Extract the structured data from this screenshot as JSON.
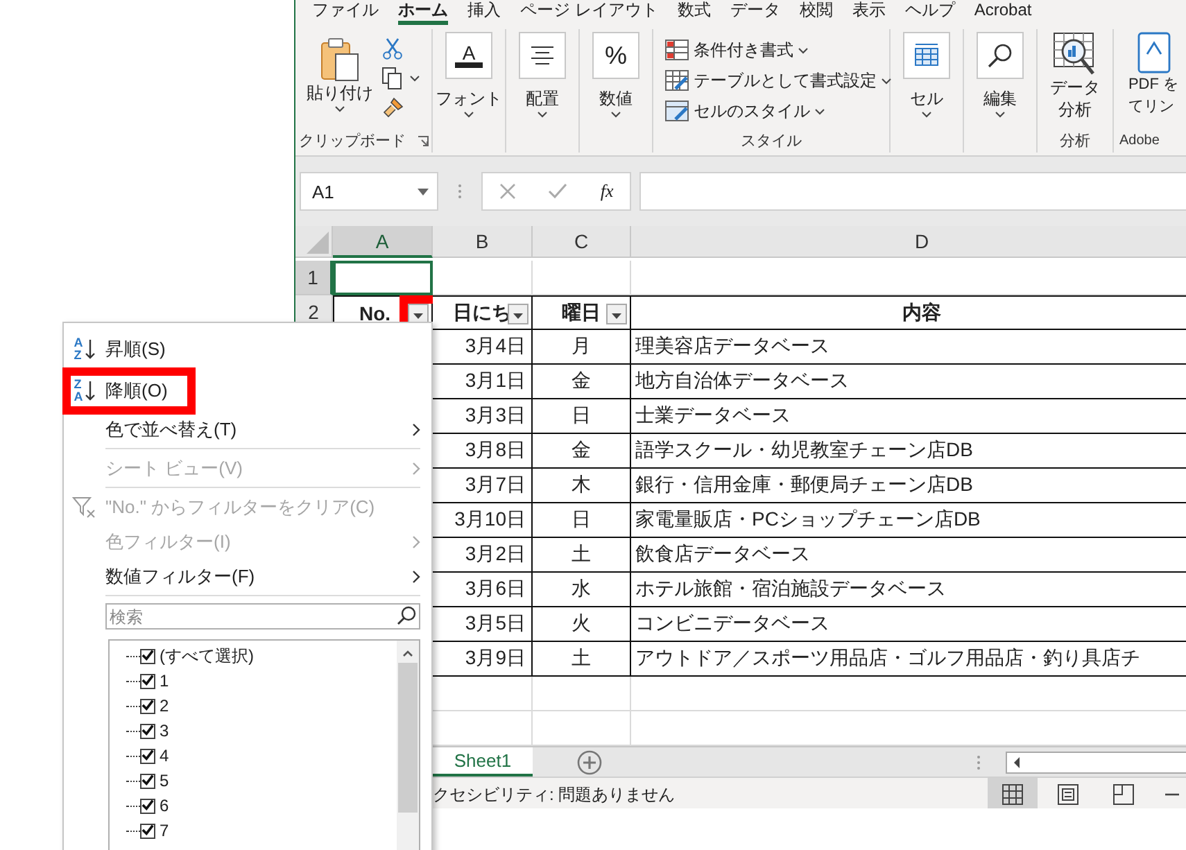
{
  "ribbon_tabs": [
    {
      "label": "ファイル",
      "selected": false
    },
    {
      "label": "ホーム",
      "selected": true
    },
    {
      "label": "挿入",
      "selected": false
    },
    {
      "label": "ページ レイアウト",
      "selected": false
    },
    {
      "label": "数式",
      "selected": false
    },
    {
      "label": "データ",
      "selected": false
    },
    {
      "label": "校閲",
      "selected": false
    },
    {
      "label": "表示",
      "selected": false
    },
    {
      "label": "ヘルプ",
      "selected": false
    },
    {
      "label": "Acrobat",
      "selected": false
    }
  ],
  "ribbon_groups": [
    {
      "kind": "clipboard",
      "paste": "貼り付け",
      "label": "クリップボード"
    },
    {
      "kind": "font",
      "glyph": "A",
      "title": "フォント"
    },
    {
      "kind": "align",
      "title": "配置"
    },
    {
      "kind": "number",
      "glyph": "%",
      "title": "数値"
    },
    {
      "kind": "styles",
      "items": [
        "条件付き書式",
        "テーブルとして書式設定",
        "セルのスタイル"
      ],
      "label": "スタイル"
    },
    {
      "kind": "cells",
      "title": "セル"
    },
    {
      "kind": "edit",
      "title": "編集"
    },
    {
      "kind": "analysis",
      "lines": [
        "データ",
        "分析"
      ],
      "label": "分析"
    },
    {
      "kind": "adobe",
      "lines": [
        "PDF を",
        "てリン"
      ],
      "label": "Adobe"
    }
  ],
  "formula_bar": {
    "name_box": "A1",
    "fx": "fx"
  },
  "columns": [
    {
      "label": "A",
      "selected": true
    },
    {
      "label": "B",
      "selected": false
    },
    {
      "label": "C",
      "selected": false
    },
    {
      "label": "D",
      "selected": false
    }
  ],
  "row_numbers": [
    {
      "label": "1",
      "selected": true
    },
    {
      "label": "2",
      "selected": false
    }
  ],
  "header": [
    {
      "text": "No.",
      "filter": true,
      "highlighted": true
    },
    {
      "text": "日にち",
      "filter": true,
      "highlighted": false
    },
    {
      "text": "曜日",
      "filter": true,
      "highlighted": false
    },
    {
      "text": "内容",
      "filter": false,
      "highlighted": false
    }
  ],
  "rows": [
    {
      "date": "3月4日",
      "day": "月",
      "content": "理美容店データベース"
    },
    {
      "date": "3月1日",
      "day": "金",
      "content": "地方自治体データベース"
    },
    {
      "date": "3月3日",
      "day": "日",
      "content": "士業データベース"
    },
    {
      "date": "3月8日",
      "day": "金",
      "content": "語学スクール・幼児教室チェーン店DB"
    },
    {
      "date": "3月7日",
      "day": "木",
      "content": "銀行・信用金庫・郵便局チェーン店DB"
    },
    {
      "date": "3月10日",
      "day": "日",
      "content": "家電量販店・PCショップチェーン店DB"
    },
    {
      "date": "3月2日",
      "day": "土",
      "content": "飲食店データベース"
    },
    {
      "date": "3月6日",
      "day": "水",
      "content": "ホテル旅館・宿泊施設データベース"
    },
    {
      "date": "3月5日",
      "day": "火",
      "content": "コンビニデータベース"
    },
    {
      "date": "3月9日",
      "day": "土",
      "content": "アウトドア／スポーツ用品店・ゴルフ用品店・釣り具店チ"
    }
  ],
  "sheet_tabs": [
    {
      "label": "Sheet1",
      "selected": true
    }
  ],
  "status_bar": {
    "text": "クセシビリティ: 問題ありません",
    "views": [
      {
        "kind": "normal",
        "selected": true
      },
      {
        "kind": "page_layout",
        "selected": false
      },
      {
        "kind": "page_break",
        "selected": false
      }
    ]
  },
  "filter_menu": {
    "items": [
      {
        "kind": "sort",
        "icon": [
          "A",
          "Z"
        ],
        "label": "昇順(S)",
        "disabled": false,
        "submenu": false,
        "highlighted": false,
        "separator_after": false
      },
      {
        "kind": "sort",
        "icon": [
          "Z",
          "A"
        ],
        "label": "降順(O)",
        "disabled": false,
        "submenu": false,
        "highlighted": true,
        "separator_after": false
      },
      {
        "kind": "plain",
        "label": "色で並べ替え(T)",
        "disabled": false,
        "submenu": true,
        "highlighted": false,
        "separator_after": true
      },
      {
        "kind": "plain",
        "label": "シート ビュー(V)",
        "disabled": true,
        "submenu": true,
        "highlighted": false,
        "separator_after": true
      },
      {
        "kind": "clear",
        "label": "\"No.\" からフィルターをクリア(C)",
        "disabled": true,
        "submenu": false,
        "highlighted": false,
        "separator_after": false
      },
      {
        "kind": "plain",
        "label": "色フィルター(I)",
        "disabled": true,
        "submenu": true,
        "highlighted": false,
        "separator_after": false
      },
      {
        "kind": "plain",
        "label": "数値フィルター(F)",
        "disabled": false,
        "submenu": true,
        "highlighted": false,
        "separator_after": true
      }
    ],
    "search": {
      "placeholder": "検索"
    },
    "values": [
      {
        "label": "(すべて選択)",
        "checked": true
      },
      {
        "label": "1",
        "checked": true
      },
      {
        "label": "2",
        "checked": true
      },
      {
        "label": "3",
        "checked": true
      },
      {
        "label": "4",
        "checked": true
      },
      {
        "label": "5",
        "checked": true
      },
      {
        "label": "6",
        "checked": true
      },
      {
        "label": "7",
        "checked": true
      }
    ]
  }
}
